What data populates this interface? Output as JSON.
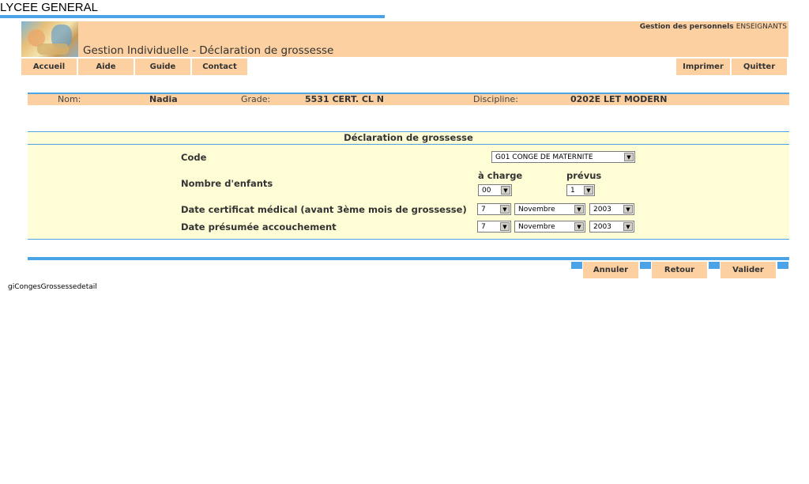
{
  "header": {
    "school_name": "LYCEE GENERAL",
    "app_subtitle_prefix": "Gestion des personnels",
    "app_subtitle_accent": "ENSEIGNANTS",
    "page_title": "Gestion Individuelle - Déclaration de grossesse"
  },
  "nav": {
    "home": "Accueil",
    "help": "Aide",
    "guide": "Guide",
    "contact": "Contact",
    "print": "Imprimer",
    "quit": "Quitter"
  },
  "info": {
    "name_label": "Nom:",
    "name_value": "Nadia",
    "grade_label": "Grade:",
    "grade_value": "5531 CERT. CL N",
    "discipline_label": "Discipline:",
    "discipline_value": "0202E LET MODERN"
  },
  "form": {
    "title": "Déclaration de grossesse",
    "code_label": "Code",
    "code_value": "G01 CONGE DE MATERNITE",
    "children_label": "Nombre d'enfants",
    "charge_label": "à charge",
    "charge_value": "00",
    "expected_label": "prévus",
    "expected_value": "1",
    "cert_label": "Date certificat médical (avant 3ème mois de grossesse)",
    "cert_day": "7",
    "cert_month": "Novembre",
    "cert_year": "2003",
    "birth_label": "Date présumée accouchement",
    "birth_day": "7",
    "birth_month": "Novembre",
    "birth_year": "2003"
  },
  "actions": {
    "cancel": "Annuler",
    "back": "Retour",
    "validate": "Valider"
  },
  "page_id": "giCongesGrossessedetail",
  "colors": {
    "accent_blue": "#4aa3e6",
    "header_orange": "#fcd0a1",
    "form_yellow": "#fffdd6"
  }
}
